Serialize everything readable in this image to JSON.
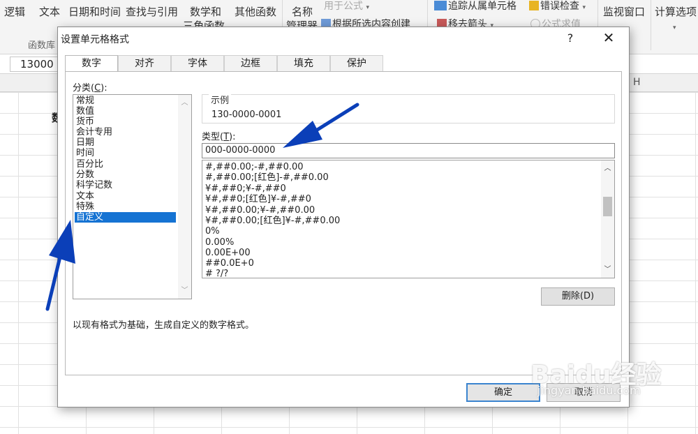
{
  "ribbon": {
    "items": {
      "logic": "逻辑",
      "text": "文本",
      "datetime": "日期和时间",
      "lookup": "查找与引用",
      "math_line1": "数学和",
      "math_line2": "三角函数",
      "other": "其他函数",
      "name_line1": "名称",
      "name_line2": "管理器",
      "use_in_formula": "用于公式",
      "create_from_selection": "根据所选内容创建",
      "trace_dependents": "追踪从属单元格",
      "remove_arrows": "移去箭头",
      "error_checking": "错误检查",
      "evaluate_formula": "公式求值",
      "watch_window": "监视窗口",
      "calc_options": "计算选项"
    },
    "group_label": "函数库"
  },
  "formula_bar": {
    "name_box_value": "13000"
  },
  "sheet": {
    "col_h": "H",
    "cell_fragment": "数"
  },
  "dialog": {
    "title": "设置单元格格式",
    "help": "?",
    "close": "✕",
    "tabs": [
      "数字",
      "对齐",
      "字体",
      "边框",
      "填充",
      "保护"
    ],
    "active_tab": "数字",
    "category_label": "分类(C):",
    "category_key": "C",
    "categories": [
      "常规",
      "数值",
      "货币",
      "会计专用",
      "日期",
      "时间",
      "百分比",
      "分数",
      "科学记数",
      "文本",
      "特殊",
      "自定义"
    ],
    "selected_category": "自定义",
    "sample_legend": "示例",
    "sample_value": "130-0000-0001",
    "type_label": "类型(T):",
    "type_key": "T",
    "type_value": "000-0000-0000",
    "formats": [
      "#,##0.00;-#,##0.00",
      "#,##0.00;[红色]-#,##0.00",
      "¥#,##0;¥-#,##0",
      "¥#,##0;[红色]¥-#,##0",
      "¥#,##0.00;¥-#,##0.00",
      "¥#,##0.00;[红色]¥-#,##0.00",
      "0%",
      "0.00%",
      "0.00E+00",
      "##0.0E+0",
      "# ?/?"
    ],
    "delete_button": "删除(D)",
    "description": "以现有格式为基础，生成自定义的数字格式。",
    "ok_button": "确定",
    "cancel_button": "取消"
  },
  "watermark": {
    "logo": "Baidu经验",
    "sub": "jingyan.baidu.com"
  },
  "colors": {
    "selection": "#1573d3",
    "arrow": "#0b3fb8",
    "ok_border": "#3a84cf"
  }
}
